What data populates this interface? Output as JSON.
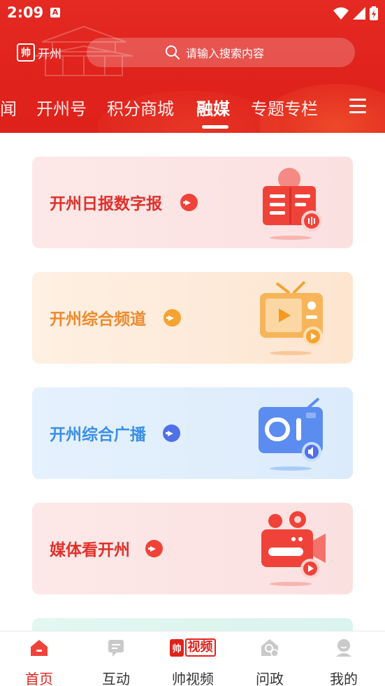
{
  "status_bar": {
    "time": "2:09",
    "notification_icon": "A"
  },
  "header": {
    "logo_text": "开州",
    "logo_mark": "帅",
    "search_placeholder": "请输入搜索内容"
  },
  "tabs": [
    {
      "label": "闻"
    },
    {
      "label": "开州号"
    },
    {
      "label": "积分商城"
    },
    {
      "label": "融媒",
      "active": true
    },
    {
      "label": "专题专栏"
    }
  ],
  "cards": [
    {
      "title": "开州日报数字报",
      "icon": "newspaper-reader-icon"
    },
    {
      "title": "开州综合频道",
      "icon": "tv-play-icon"
    },
    {
      "title": "开州综合广播",
      "icon": "radio-icon"
    },
    {
      "title": "媒体看开州",
      "icon": "video-camera-icon"
    }
  ],
  "bottom_nav": [
    {
      "label": "首页",
      "icon": "home-icon",
      "active": true
    },
    {
      "label": "互动",
      "icon": "chat-icon"
    },
    {
      "label": "帅视频",
      "icon": "shuai-video-logo",
      "logo_a": "帅",
      "logo_b": "视频"
    },
    {
      "label": "问政",
      "icon": "question-house-icon"
    },
    {
      "label": "我的",
      "icon": "user-icon"
    }
  ],
  "colors": {
    "brand_red": "#e0221c",
    "card_red": "#e0312b",
    "card_orange": "#ef8a2d",
    "card_blue": "#3a8fe8"
  }
}
